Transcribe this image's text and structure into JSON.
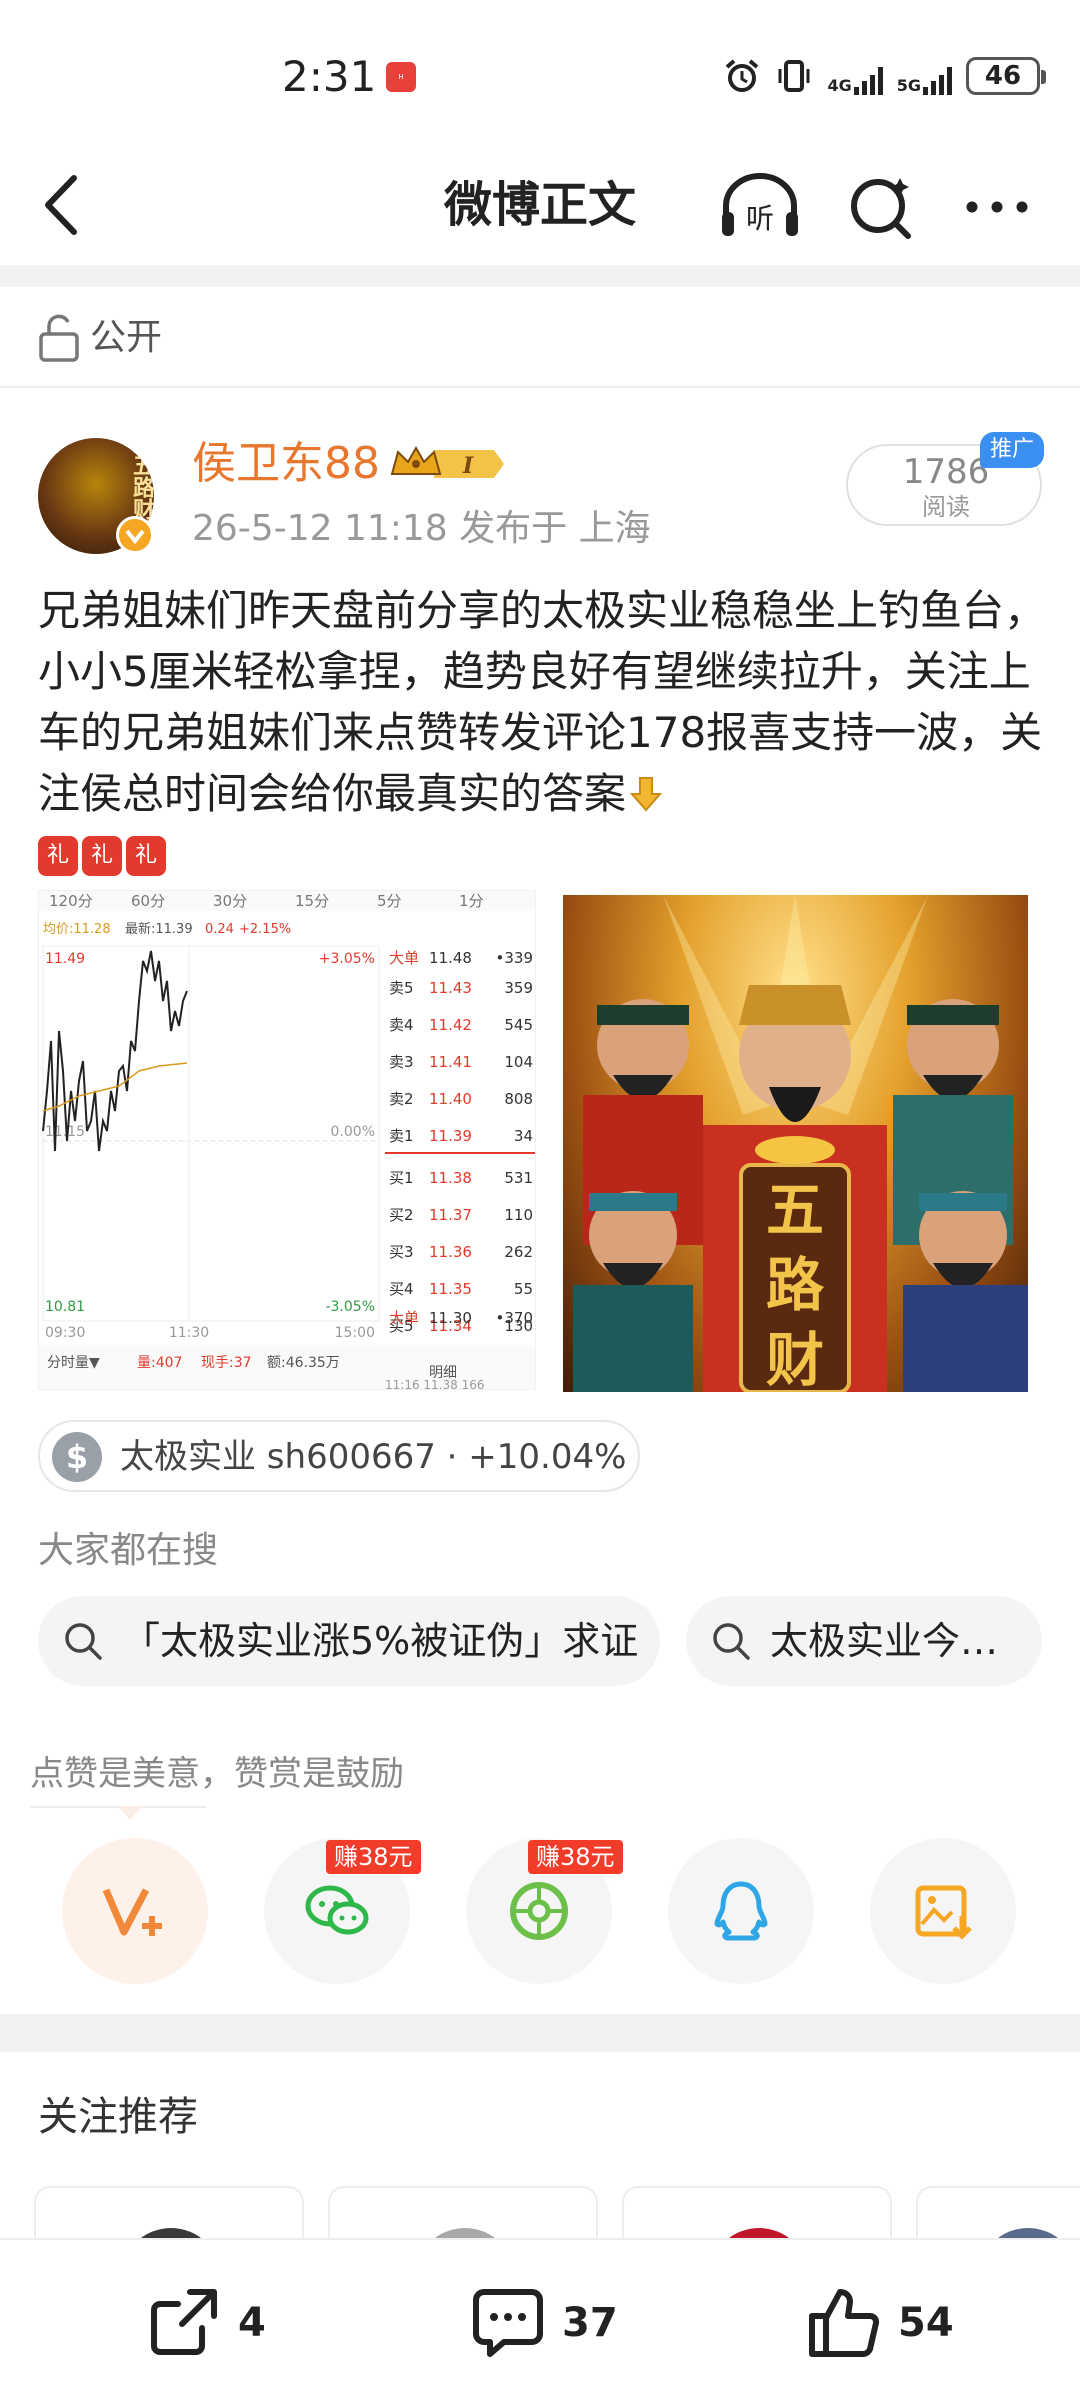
{
  "status_bar": {
    "time": "2:31",
    "network_1": "4G",
    "network_2": "5G",
    "battery": "46"
  },
  "header": {
    "title": "微博正文",
    "listen_label": "听"
  },
  "visibility": {
    "label": "公开"
  },
  "post": {
    "author": "侯卫东88",
    "vip_level": "I",
    "avatar_text": "五路财神",
    "meta": "26-5-12 11:18  发布于 上海",
    "read_count": "1786",
    "read_label": "阅读",
    "promo_tag": "推广",
    "text": "兄弟姐妹们昨天盘前分享的太极实业稳稳坐上钓鱼台，小小5厘米轻松拿捏，趋势良好有望继续拉升，关注上车的兄弟姐妹们来点赞转发评论178报喜支持一波，关注侯总时间会给你最真实的答案",
    "gift_emoji": [
      "礼",
      "礼",
      "礼"
    ]
  },
  "stock_image": {
    "tabs": [
      "120分",
      "60分",
      "30分",
      "15分",
      "5分",
      "1分"
    ],
    "avg_label": "均价:11.28",
    "latest_label": "最新:11.39",
    "change_abs": "0.24",
    "change_pct": "+2.15%",
    "price_high": "11.49",
    "price_mid": "11.15",
    "price_low": "10.81",
    "pct_high": "+3.05%",
    "pct_mid": "0.00%",
    "pct_low": "-3.05%",
    "time_start": "09:30",
    "time_mid": "11:30",
    "time_end": "15:00",
    "footer_left": "分时量▼",
    "footer_vol": "量:407",
    "footer_hand": "现手:37",
    "footer_amount": "额:46.35万",
    "footer_detail": "明细",
    "big_order_label": "大单",
    "big_order_top": {
      "price": "11.48",
      "vol": "•339"
    },
    "big_order_bottom": {
      "price": "11.30",
      "vol": "•370"
    },
    "bottom_partial": "11:16  11.38  166",
    "sells": [
      {
        "label": "卖5",
        "price": "11.43",
        "vol": "359"
      },
      {
        "label": "卖4",
        "price": "11.42",
        "vol": "545"
      },
      {
        "label": "卖3",
        "price": "11.41",
        "vol": "104"
      },
      {
        "label": "卖2",
        "price": "11.40",
        "vol": "808"
      },
      {
        "label": "卖1",
        "price": "11.39",
        "vol": "34"
      }
    ],
    "buys": [
      {
        "label": "买1",
        "price": "11.38",
        "vol": "531"
      },
      {
        "label": "买2",
        "price": "11.37",
        "vol": "110"
      },
      {
        "label": "买3",
        "price": "11.36",
        "vol": "262"
      },
      {
        "label": "买4",
        "price": "11.35",
        "vol": "55"
      },
      {
        "label": "买5",
        "price": "11.34",
        "vol": "130"
      }
    ]
  },
  "god_image": {
    "banner_chars": [
      "五",
      "路",
      "财"
    ]
  },
  "stock_chip": {
    "icon": "$",
    "label": "太极实业 sh600667 · +10.04%"
  },
  "hot_search": {
    "title": "大家都在搜",
    "items": [
      "「太极实业涨5%被证伪」求证",
      "太极实业今…"
    ]
  },
  "reward": {
    "title": "点赞是美意，赞赏是鼓励",
    "earn_tags": [
      "赚38元",
      "赚38元"
    ]
  },
  "recommend": {
    "title": "关注推荐"
  },
  "bottom_bar": {
    "repost_count": "4",
    "comment_count": "37",
    "like_count": "54"
  },
  "colors": {
    "accent_orange": "#e8762d",
    "rise_red": "#e23a2c",
    "fall_green": "#2e9a44",
    "promo_blue": "#3a8ff0"
  }
}
